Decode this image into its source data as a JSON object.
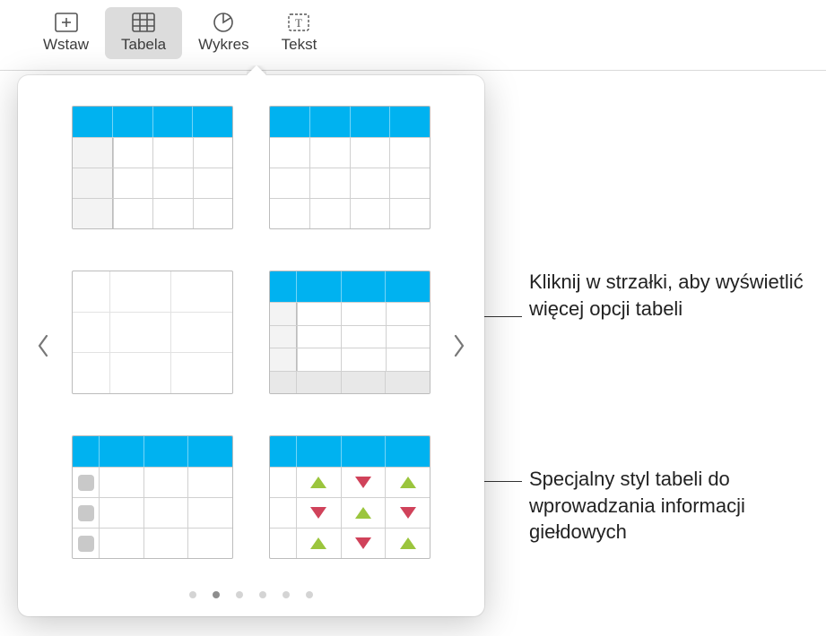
{
  "toolbar": {
    "items": [
      {
        "label": "Wstaw",
        "icon": "insert-icon"
      },
      {
        "label": "Tabela",
        "icon": "table-icon",
        "active": true
      },
      {
        "label": "Wykres",
        "icon": "chart-icon"
      },
      {
        "label": "Tekst",
        "icon": "text-icon"
      }
    ]
  },
  "popover": {
    "page_index": 1,
    "page_count": 6,
    "styles": [
      {
        "id": "header-col-highlight"
      },
      {
        "id": "header-only"
      },
      {
        "id": "plain-no-header"
      },
      {
        "id": "header-sidebar-footer"
      },
      {
        "id": "header-checkbox-col"
      },
      {
        "id": "stock-triangles"
      }
    ]
  },
  "callouts": {
    "right_arrow": "Kliknij w strzałki, aby wyświetlić więcej opcji tabeli",
    "stock_style": "Specjalny styl tabeli do wprowadzania informacji giełdowych"
  },
  "colors": {
    "accent": "#00b2f0",
    "up": "#9bc53d",
    "down": "#d0425a"
  }
}
